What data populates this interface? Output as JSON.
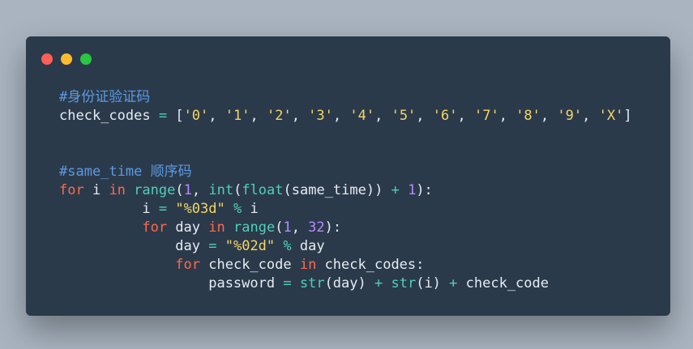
{
  "colors": {
    "page_background": "#a9b4c0",
    "window_background": "#2b3a4b",
    "close": "#ff5f57",
    "minimize": "#febc2e",
    "maximize": "#28c840",
    "comment": "#5c9ae0",
    "keyword": "#ff6a4a",
    "builtin": "#4fd0b8",
    "number": "#b589ff",
    "string": "#f5d562",
    "text": "#e6ebf0"
  },
  "window_controls": [
    {
      "name": "close-button",
      "icon": "red-circle"
    },
    {
      "name": "minimize-button",
      "icon": "yellow-circle"
    },
    {
      "name": "maximize-button",
      "icon": "green-circle"
    }
  ],
  "code_lines": [
    [
      {
        "t": "comment",
        "v": "#身份证验证码"
      }
    ],
    [
      {
        "t": "ident",
        "v": "check_codes "
      },
      {
        "t": "op",
        "v": "="
      },
      {
        "t": "ident",
        "v": " ["
      },
      {
        "t": "string",
        "v": "'0'"
      },
      {
        "t": "ident",
        "v": ", "
      },
      {
        "t": "string",
        "v": "'1'"
      },
      {
        "t": "ident",
        "v": ", "
      },
      {
        "t": "string",
        "v": "'2'"
      },
      {
        "t": "ident",
        "v": ", "
      },
      {
        "t": "string",
        "v": "'3'"
      },
      {
        "t": "ident",
        "v": ", "
      },
      {
        "t": "string",
        "v": "'4'"
      },
      {
        "t": "ident",
        "v": ", "
      },
      {
        "t": "string",
        "v": "'5'"
      },
      {
        "t": "ident",
        "v": ", "
      },
      {
        "t": "string",
        "v": "'6'"
      },
      {
        "t": "ident",
        "v": ", "
      },
      {
        "t": "string",
        "v": "'7'"
      },
      {
        "t": "ident",
        "v": ", "
      },
      {
        "t": "string",
        "v": "'8'"
      },
      {
        "t": "ident",
        "v": ", "
      },
      {
        "t": "string",
        "v": "'9'"
      },
      {
        "t": "ident",
        "v": ", "
      },
      {
        "t": "string",
        "v": "'X'"
      },
      {
        "t": "ident",
        "v": "]"
      }
    ],
    [],
    [],
    [
      {
        "t": "comment",
        "v": "#same_time 顺序码"
      }
    ],
    [
      {
        "t": "keyword",
        "v": "for"
      },
      {
        "t": "ident",
        "v": " i "
      },
      {
        "t": "keyword",
        "v": "in"
      },
      {
        "t": "ident",
        "v": " "
      },
      {
        "t": "builtin",
        "v": "range"
      },
      {
        "t": "ident",
        "v": "("
      },
      {
        "t": "number",
        "v": "1"
      },
      {
        "t": "ident",
        "v": ", "
      },
      {
        "t": "builtin",
        "v": "int"
      },
      {
        "t": "ident",
        "v": "("
      },
      {
        "t": "builtin",
        "v": "float"
      },
      {
        "t": "ident",
        "v": "(same_time)) "
      },
      {
        "t": "op",
        "v": "+"
      },
      {
        "t": "ident",
        "v": " "
      },
      {
        "t": "number",
        "v": "1"
      },
      {
        "t": "ident",
        "v": "):"
      }
    ],
    [
      {
        "t": "ident",
        "v": "          i "
      },
      {
        "t": "op",
        "v": "="
      },
      {
        "t": "ident",
        "v": " "
      },
      {
        "t": "string",
        "v": "\"%03d\""
      },
      {
        "t": "ident",
        "v": " "
      },
      {
        "t": "op",
        "v": "%"
      },
      {
        "t": "ident",
        "v": " i"
      }
    ],
    [
      {
        "t": "ident",
        "v": "          "
      },
      {
        "t": "keyword",
        "v": "for"
      },
      {
        "t": "ident",
        "v": " day "
      },
      {
        "t": "keyword",
        "v": "in"
      },
      {
        "t": "ident",
        "v": " "
      },
      {
        "t": "builtin",
        "v": "range"
      },
      {
        "t": "ident",
        "v": "("
      },
      {
        "t": "number",
        "v": "1"
      },
      {
        "t": "ident",
        "v": ", "
      },
      {
        "t": "number",
        "v": "32"
      },
      {
        "t": "ident",
        "v": "):"
      }
    ],
    [
      {
        "t": "ident",
        "v": "              day "
      },
      {
        "t": "op",
        "v": "="
      },
      {
        "t": "ident",
        "v": " "
      },
      {
        "t": "string",
        "v": "\"%02d\""
      },
      {
        "t": "ident",
        "v": " "
      },
      {
        "t": "op",
        "v": "%"
      },
      {
        "t": "ident",
        "v": " day"
      }
    ],
    [
      {
        "t": "ident",
        "v": "              "
      },
      {
        "t": "keyword",
        "v": "for"
      },
      {
        "t": "ident",
        "v": " check_code "
      },
      {
        "t": "keyword",
        "v": "in"
      },
      {
        "t": "ident",
        "v": " check_codes:"
      }
    ],
    [
      {
        "t": "ident",
        "v": "                  password "
      },
      {
        "t": "op",
        "v": "="
      },
      {
        "t": "ident",
        "v": " "
      },
      {
        "t": "builtin",
        "v": "str"
      },
      {
        "t": "ident",
        "v": "(day) "
      },
      {
        "t": "op",
        "v": "+"
      },
      {
        "t": "ident",
        "v": " "
      },
      {
        "t": "builtin",
        "v": "str"
      },
      {
        "t": "ident",
        "v": "(i) "
      },
      {
        "t": "op",
        "v": "+"
      },
      {
        "t": "ident",
        "v": " check_code"
      }
    ]
  ]
}
